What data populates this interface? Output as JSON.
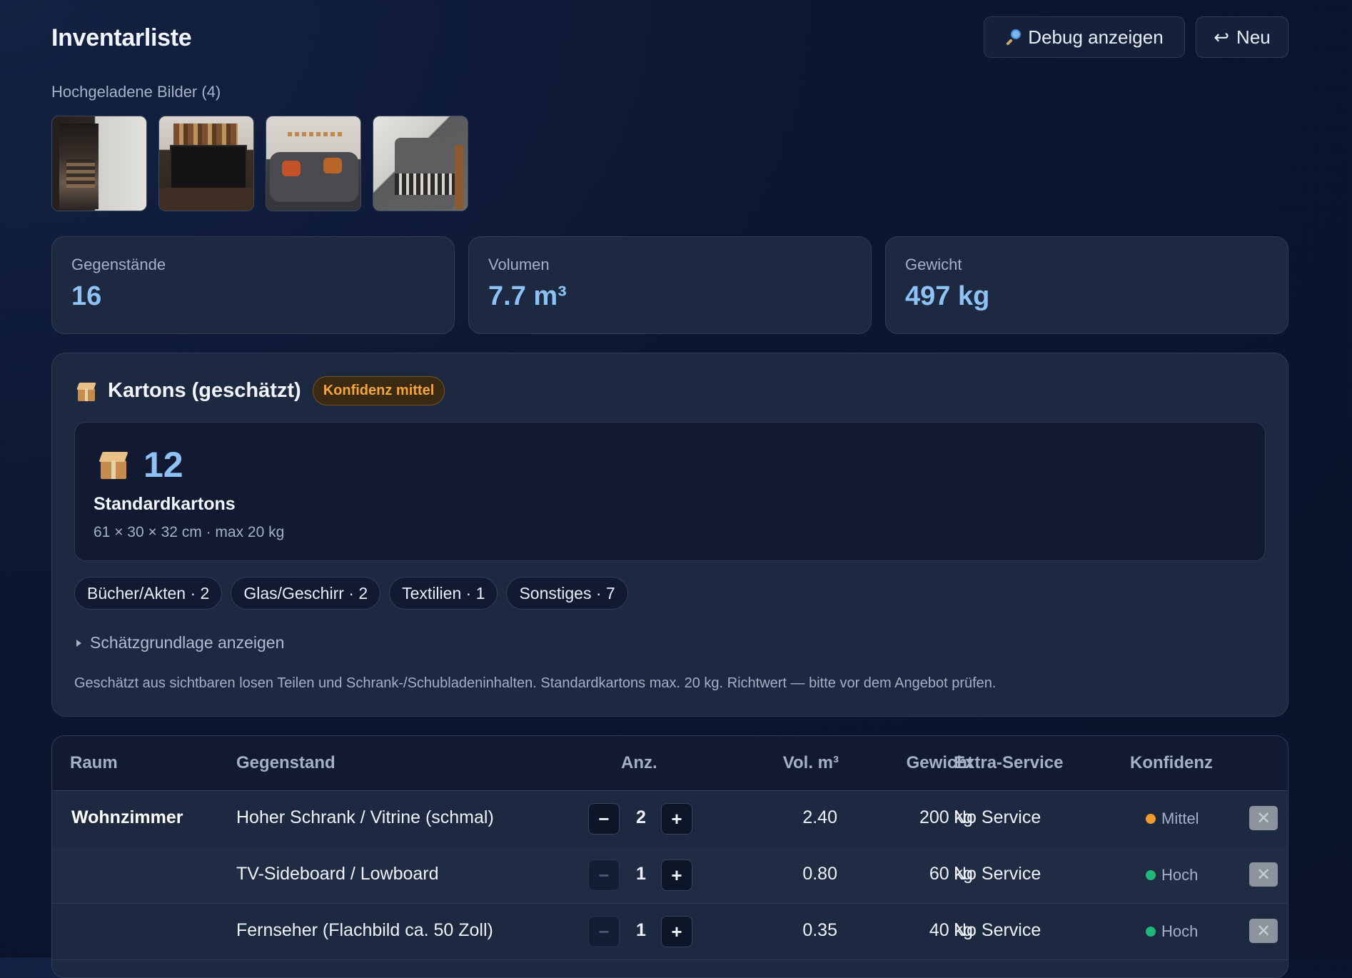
{
  "header": {
    "title": "Inventarliste",
    "debug_label": "Debug anzeigen",
    "new_label": "Neu",
    "debug_icon": "magnifier-icon",
    "new_icon": "return-arrow-icon",
    "new_glyph": "↩"
  },
  "images": {
    "label": "Hochgeladene Bilder (4)"
  },
  "stats": [
    {
      "label": "Gegenstände",
      "value": "16"
    },
    {
      "label": "Volumen",
      "value": "7.7 m³"
    },
    {
      "label": "Gewicht",
      "value": "497 kg"
    }
  ],
  "boxes": {
    "title": "Kartons (geschätzt)",
    "confidence": "Konfidenz mittel",
    "count": "12",
    "name": "Standardkartons",
    "dims": "61 × 30 × 32 cm · max 20 kg",
    "chips": [
      "Bücher/Akten · 2",
      "Glas/Geschirr · 2",
      "Textilien · 1",
      "Sonstiges · 7"
    ],
    "basis_toggle": "Schätzgrundlage anzeigen",
    "note": "Geschätzt aus sichtbaren losen Teilen und Schrank-/Schubladeninhalten. Standardkartons max. 20 kg. Richtwert — bitte vor dem Angebot prüfen."
  },
  "table": {
    "headers": {
      "room": "Raum",
      "item": "Gegenstand",
      "qty": "Anz.",
      "vol": "Vol. m³",
      "weight": "Gewicht",
      "service": "Extra-Service",
      "conf": "Konfidenz"
    },
    "rows": [
      {
        "room": "Wohnzimmer",
        "item": "Hoher Schrank / Vitrine (schmal)",
        "qty": "2",
        "vol": "2.40",
        "weight": "200 kg",
        "service": "No Service",
        "conf": "Mittel",
        "conf_color": "#f39c2b"
      },
      {
        "room": "",
        "item": "TV-Sideboard / Lowboard",
        "qty": "1",
        "vol": "0.80",
        "weight": "60 kg",
        "service": "No Service",
        "conf": "Hoch",
        "conf_color": "#1fb77a"
      },
      {
        "room": "",
        "item": "Fernseher (Flachbild ca. 50 Zoll)",
        "qty": "1",
        "vol": "0.35",
        "weight": "40 kg",
        "service": "No Service",
        "conf": "Hoch",
        "conf_color": "#1fb77a"
      }
    ],
    "minus": "−",
    "plus": "+",
    "delete": "✕"
  }
}
